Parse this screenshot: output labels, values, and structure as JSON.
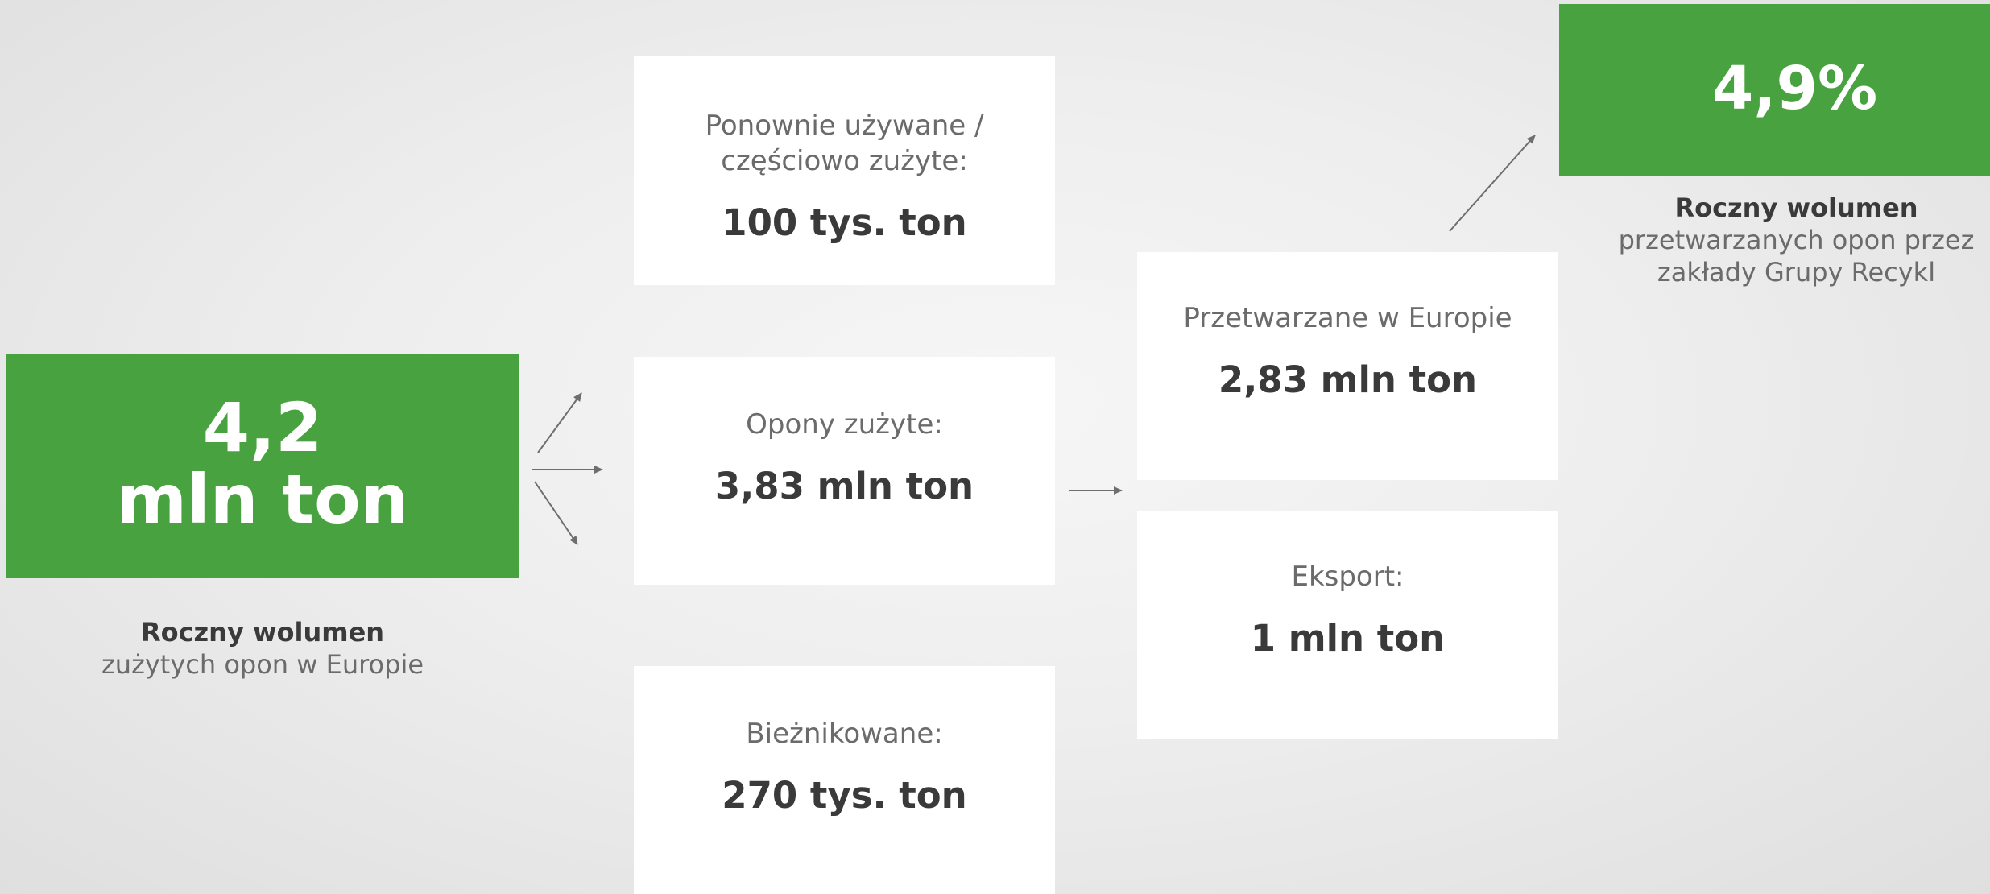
{
  "source": {
    "value_line1": "4,2",
    "value_line2": "mln ton",
    "caption_bold": "Roczny wolumen",
    "caption_text": "zużytych opon w Europie"
  },
  "reused": {
    "label_line1": "Ponownie używane /",
    "label_line2": "częściowo zużyte:",
    "value": "100 tys. ton"
  },
  "used": {
    "label": "Opony zużyte:",
    "value": "3,83 mln ton"
  },
  "retreaded": {
    "label": "Bieżnikowane:",
    "value": "270 tys. ton"
  },
  "processed": {
    "label": "Przetwarzane w Europie",
    "value": "2,83 mln ton"
  },
  "export": {
    "label": "Eksport:",
    "value": "1 mln ton"
  },
  "share": {
    "value": "4,9%",
    "caption_bold": "Roczny wolumen",
    "caption_line1": "przetwarzanych opon przez",
    "caption_line2": "zakłady Grupy Recykl"
  },
  "colors": {
    "accent_green": "#48a23f",
    "box_white": "#ffffff",
    "text_dark": "#3a3a3a",
    "text_grey": "#6b6b6b",
    "arrow_grey": "#6e6e6e"
  }
}
